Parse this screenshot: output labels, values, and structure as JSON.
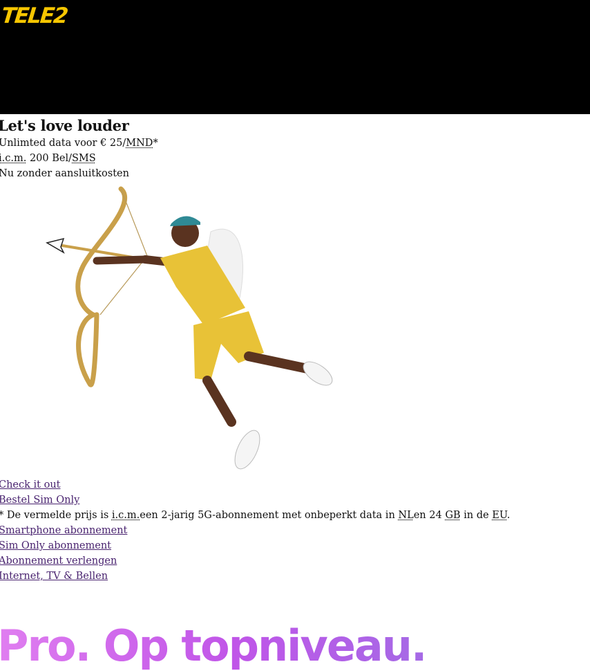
{
  "brand": {
    "logo_text": "TELE2",
    "logo_color": "#f7c600"
  },
  "hero": {
    "title": "Let's love louder",
    "line1_prefix": "Unlimted data voor € 25/",
    "line1_abbr": "MND",
    "line1_suffix": "*",
    "line2_abbr1": "i.c.m.",
    "line2_text": " 200 Bel/",
    "line2_abbr2": "SMS",
    "line3": "Nu zonder aansluitkosten"
  },
  "links": {
    "check_it_out": "Check it out",
    "bestel_sim_only": "Bestel Sim Only"
  },
  "footnote": {
    "prefix": "* De vermelde prijs is ",
    "abbr1": "i.c.m.",
    "middle": "een 2-jarig 5G-abonnement met onbeperkt data in ",
    "abbr2": "NL",
    "middle2": "en 24 ",
    "abbr3": "GB",
    "middle3": " in de ",
    "abbr4": "EU",
    "suffix": "."
  },
  "nav": [
    "Smartphone abonnement",
    "Sim Only abonnement",
    "Abonnement verlengen",
    "Internet, TV & Bellen"
  ],
  "promo": {
    "headline": "Pro. Op topniveau."
  },
  "colors": {
    "hero_bg": "#000000",
    "link": "#4a2470",
    "accent": "#f7c600",
    "promo_purple": "#c055e8"
  },
  "illustration": {
    "subject": "cupid-with-bow-and-arrow"
  }
}
